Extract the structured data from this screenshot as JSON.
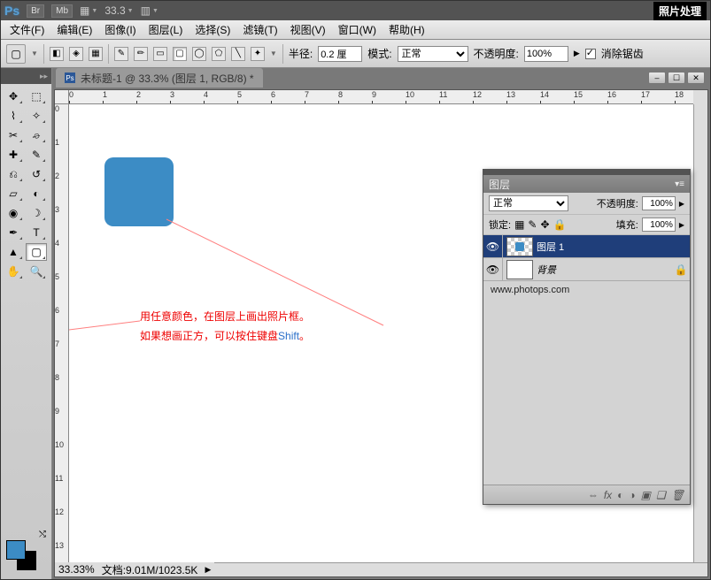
{
  "topbar": {
    "logo": "Ps",
    "br_btn": "Br",
    "mb_btn": "Mb",
    "zoom": "33.3",
    "right_label": "照片处理"
  },
  "menu": {
    "file": "文件(F)",
    "edit": "编辑(E)",
    "image": "图像(I)",
    "layer": "图层(L)",
    "select": "选择(S)",
    "filter": "滤镜(T)",
    "view": "视图(V)",
    "window": "窗口(W)",
    "help": "帮助(H)"
  },
  "opt": {
    "radius_label": "半径:",
    "radius_value": "0.2 厘",
    "mode_label": "模式:",
    "mode_value": "正常",
    "opacity_label": "不透明度:",
    "opacity_value": "100%",
    "antialias": "消除锯齿"
  },
  "doc": {
    "title": "未标题-1 @ 33.3% (图层 1, RGB/8) *",
    "status_zoom": "33.33%",
    "status_doc": "文档:9.01M/1023.5K"
  },
  "annot": {
    "line1": "用任意颜色，在图层上画出照片框。",
    "line2_a": "如果想画正方，可以按住键盘",
    "line2_b": "Shift",
    "line2_c": "。"
  },
  "layers": {
    "title": "图层",
    "blend": "正常",
    "opacity_label": "不透明度:",
    "opacity_value": "100%",
    "lock_label": "锁定:",
    "fill_label": "填充:",
    "fill_value": "100%",
    "items": [
      {
        "name": "图层 1",
        "locked": false
      },
      {
        "name": "背景",
        "locked": true
      }
    ],
    "url": "www.photops.com",
    "foot_fx": "fx"
  },
  "ruler_h": [
    0,
    1,
    2,
    3,
    4,
    5,
    6,
    7,
    8,
    9,
    10,
    11,
    12,
    13,
    14,
    15,
    16,
    17,
    18
  ],
  "ruler_v": [
    0,
    1,
    2,
    3,
    4,
    5,
    6,
    7,
    8,
    9,
    10,
    11,
    12,
    13
  ],
  "colors": {
    "fg": "#3c8cc5",
    "bg": "#000000"
  }
}
